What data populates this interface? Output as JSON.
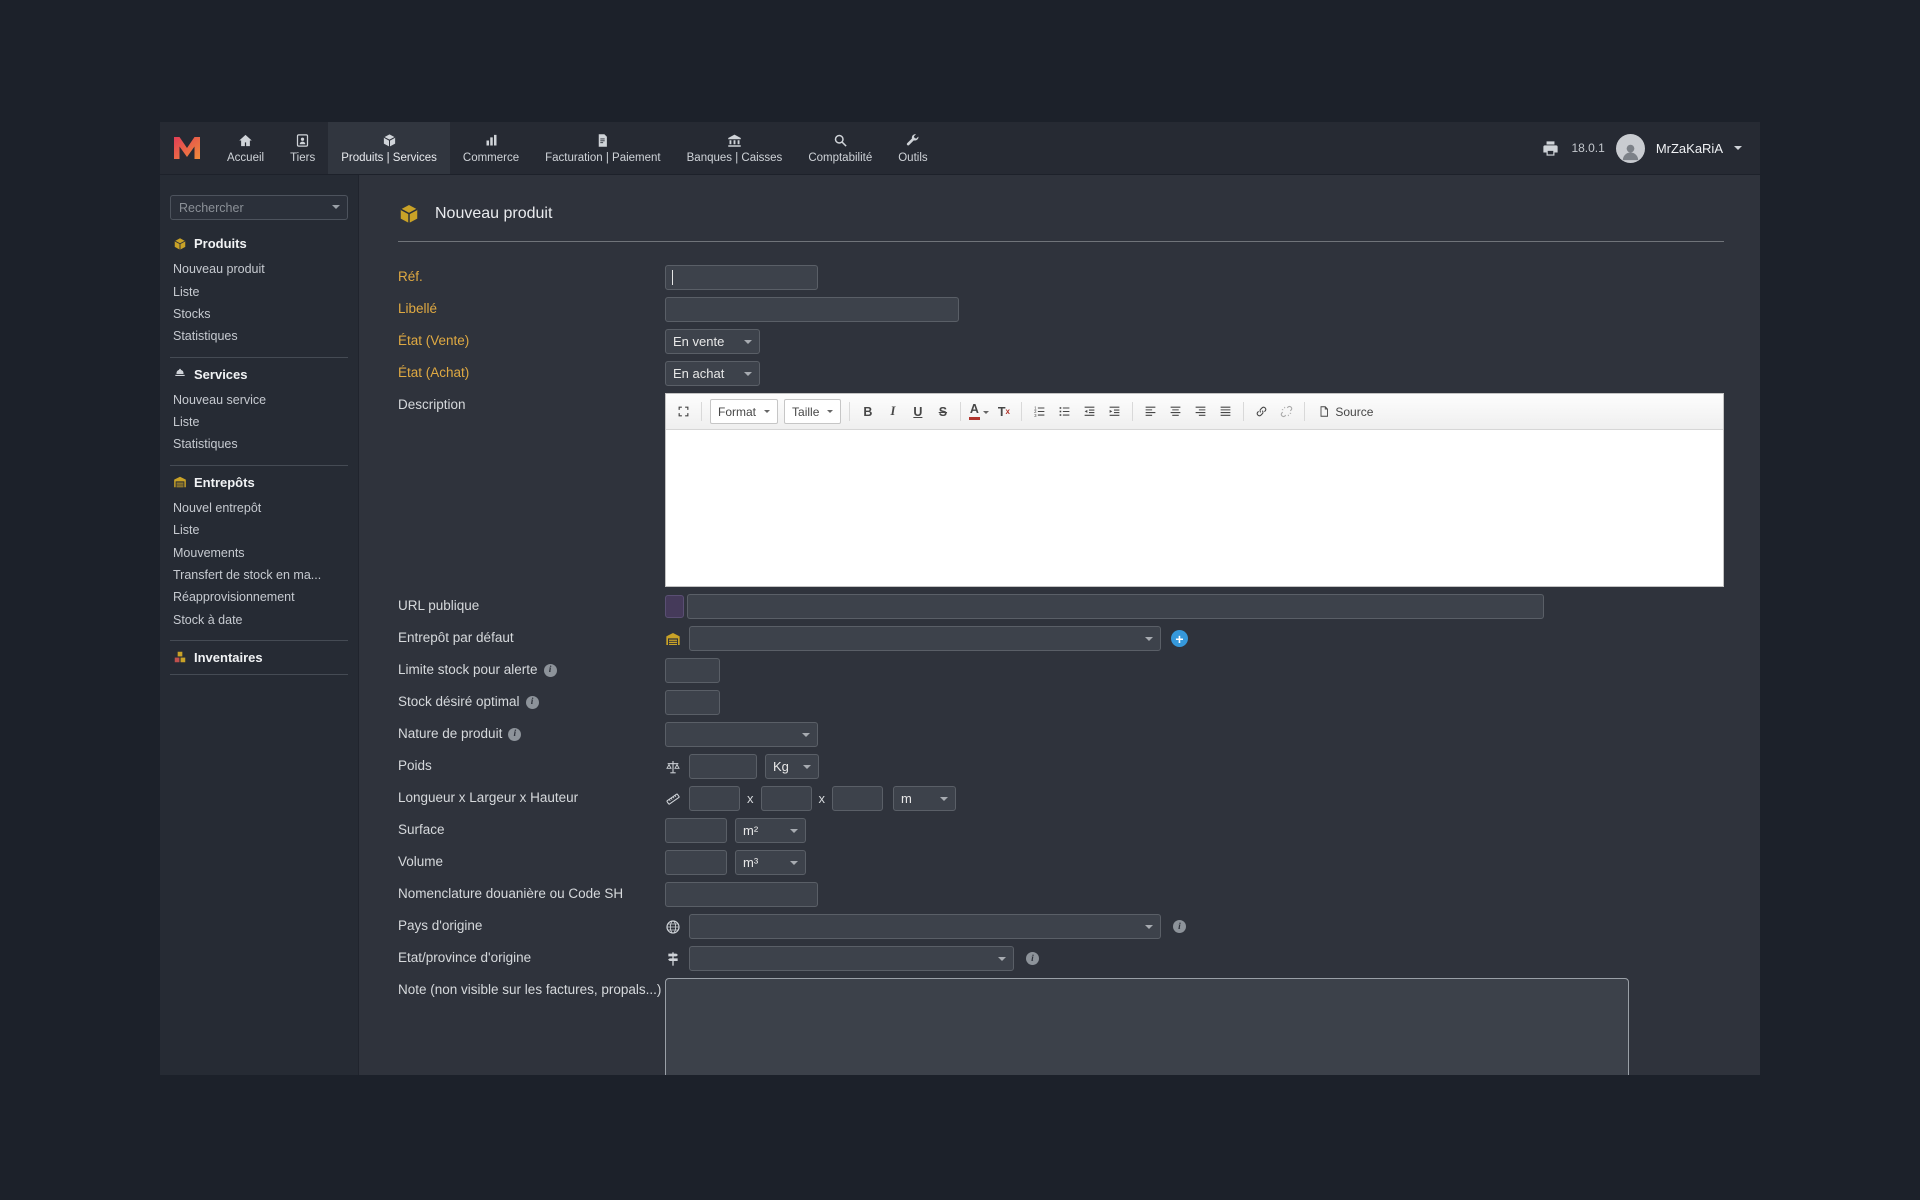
{
  "topbar": {
    "version": "18.0.1",
    "user": "MrZaKaRiA",
    "menu": [
      {
        "label": "Accueil"
      },
      {
        "label": "Tiers"
      },
      {
        "label": "Produits | Services"
      },
      {
        "label": "Commerce"
      },
      {
        "label": "Facturation | Paiement"
      },
      {
        "label": "Banques | Caisses"
      },
      {
        "label": "Comptabilité"
      },
      {
        "label": "Outils"
      }
    ]
  },
  "sidebar": {
    "search_placeholder": "Rechercher",
    "produits": {
      "title": "Produits",
      "items": [
        "Nouveau produit",
        "Liste",
        "Stocks",
        "Statistiques"
      ]
    },
    "services": {
      "title": "Services",
      "items": [
        "Nouveau service",
        "Liste",
        "Statistiques"
      ]
    },
    "entrepots": {
      "title": "Entrepôts",
      "items": [
        "Nouvel entrepôt",
        "Liste",
        "Mouvements",
        "Transfert de stock en ma...",
        "Réapprovisionnement",
        "Stock à date"
      ]
    },
    "inventaires": {
      "title": "Inventaires"
    }
  },
  "page": {
    "title": "Nouveau produit"
  },
  "form": {
    "ref_label": "Réf.",
    "libelle_label": "Libellé",
    "etat_vente_label": "État (Vente)",
    "etat_vente_value": "En vente",
    "etat_achat_label": "État (Achat)",
    "etat_achat_value": "En achat",
    "description_label": "Description",
    "url_label": "URL publique",
    "entrepot_label": "Entrepôt par défaut",
    "limite_stock_label": "Limite stock pour alerte",
    "stock_optimal_label": "Stock désiré optimal",
    "nature_label": "Nature de produit",
    "poids_label": "Poids",
    "poids_unit": "Kg",
    "dimensions_label": "Longueur x Largeur x Hauteur",
    "dims_sep": "x",
    "dimensions_unit": "m",
    "surface_label": "Surface",
    "surface_unit": "m²",
    "volume_label": "Volume",
    "volume_unit": "m³",
    "nomenclature_label": "Nomenclature douanière ou Code SH",
    "pays_label": "Pays d'origine",
    "etat_province_label": "Etat/province d'origine",
    "note_label": "Note (non visible sur les factures, propals...)"
  },
  "editor": {
    "format": "Format",
    "taille": "Taille",
    "bold": "B",
    "italic": "I",
    "underline": "U",
    "strike": "S",
    "color_a": "A",
    "rf_t": "T",
    "rf_x": "x",
    "source": "Source"
  },
  "icons": {
    "info": "i",
    "plus": "+"
  },
  "colors": {
    "required_label": "#dfa942",
    "add_button_blue": "#3598db",
    "accent_gold": "#c9a227",
    "logo_red": "#e23d55",
    "logo_orange": "#ef8b3a"
  }
}
